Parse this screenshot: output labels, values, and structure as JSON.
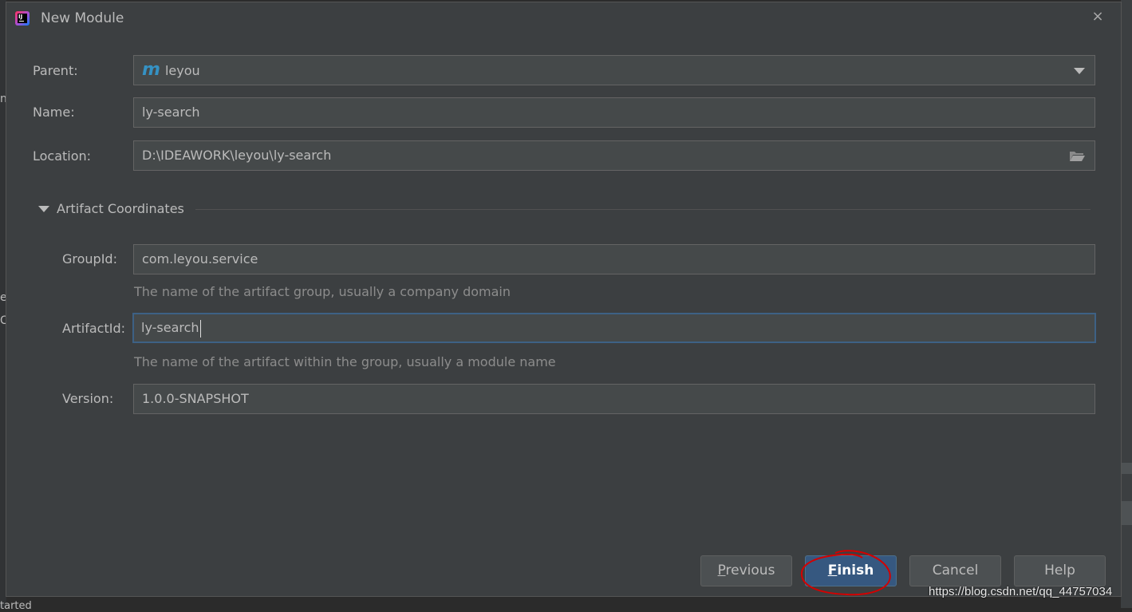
{
  "dialog": {
    "title": "New Module",
    "close_symbol": "×"
  },
  "fields": {
    "parent": {
      "label": "Parent:",
      "value": "leyou",
      "icon": "maven-module-icon",
      "icon_glyph": "m"
    },
    "name": {
      "label": "Name:",
      "value": "ly-search"
    },
    "location": {
      "label": "Location:",
      "value": "D:\\IDEAWORK\\leyou\\ly-search",
      "icon": "folder-icon"
    }
  },
  "artifact": {
    "section_title": "Artifact Coordinates",
    "group_id": {
      "label": "GroupId:",
      "value": "com.leyou.service",
      "hint": "The name of the artifact group, usually a company domain"
    },
    "artifact_id": {
      "label": "ArtifactId:",
      "value": "ly-search",
      "hint": "The name of the artifact within the group, usually a module name"
    },
    "version": {
      "label": "Version:",
      "value": "1.0.0-SNAPSHOT"
    }
  },
  "buttons": {
    "previous": "Previous",
    "finish": "Finish",
    "cancel": "Cancel",
    "help": "Help"
  },
  "colors": {
    "dialog_bg": "#3c3f41",
    "field_bg": "#45494a",
    "primary_button": "#365880",
    "focus_border": "#3d6185",
    "annotation": "#d40000"
  },
  "background": {
    "left_text_1": "n",
    "left_text_2": "e",
    "left_text_3": "C",
    "bottom_text": "tarted"
  },
  "watermark": "https://blog.csdn.net/qq_44757034"
}
